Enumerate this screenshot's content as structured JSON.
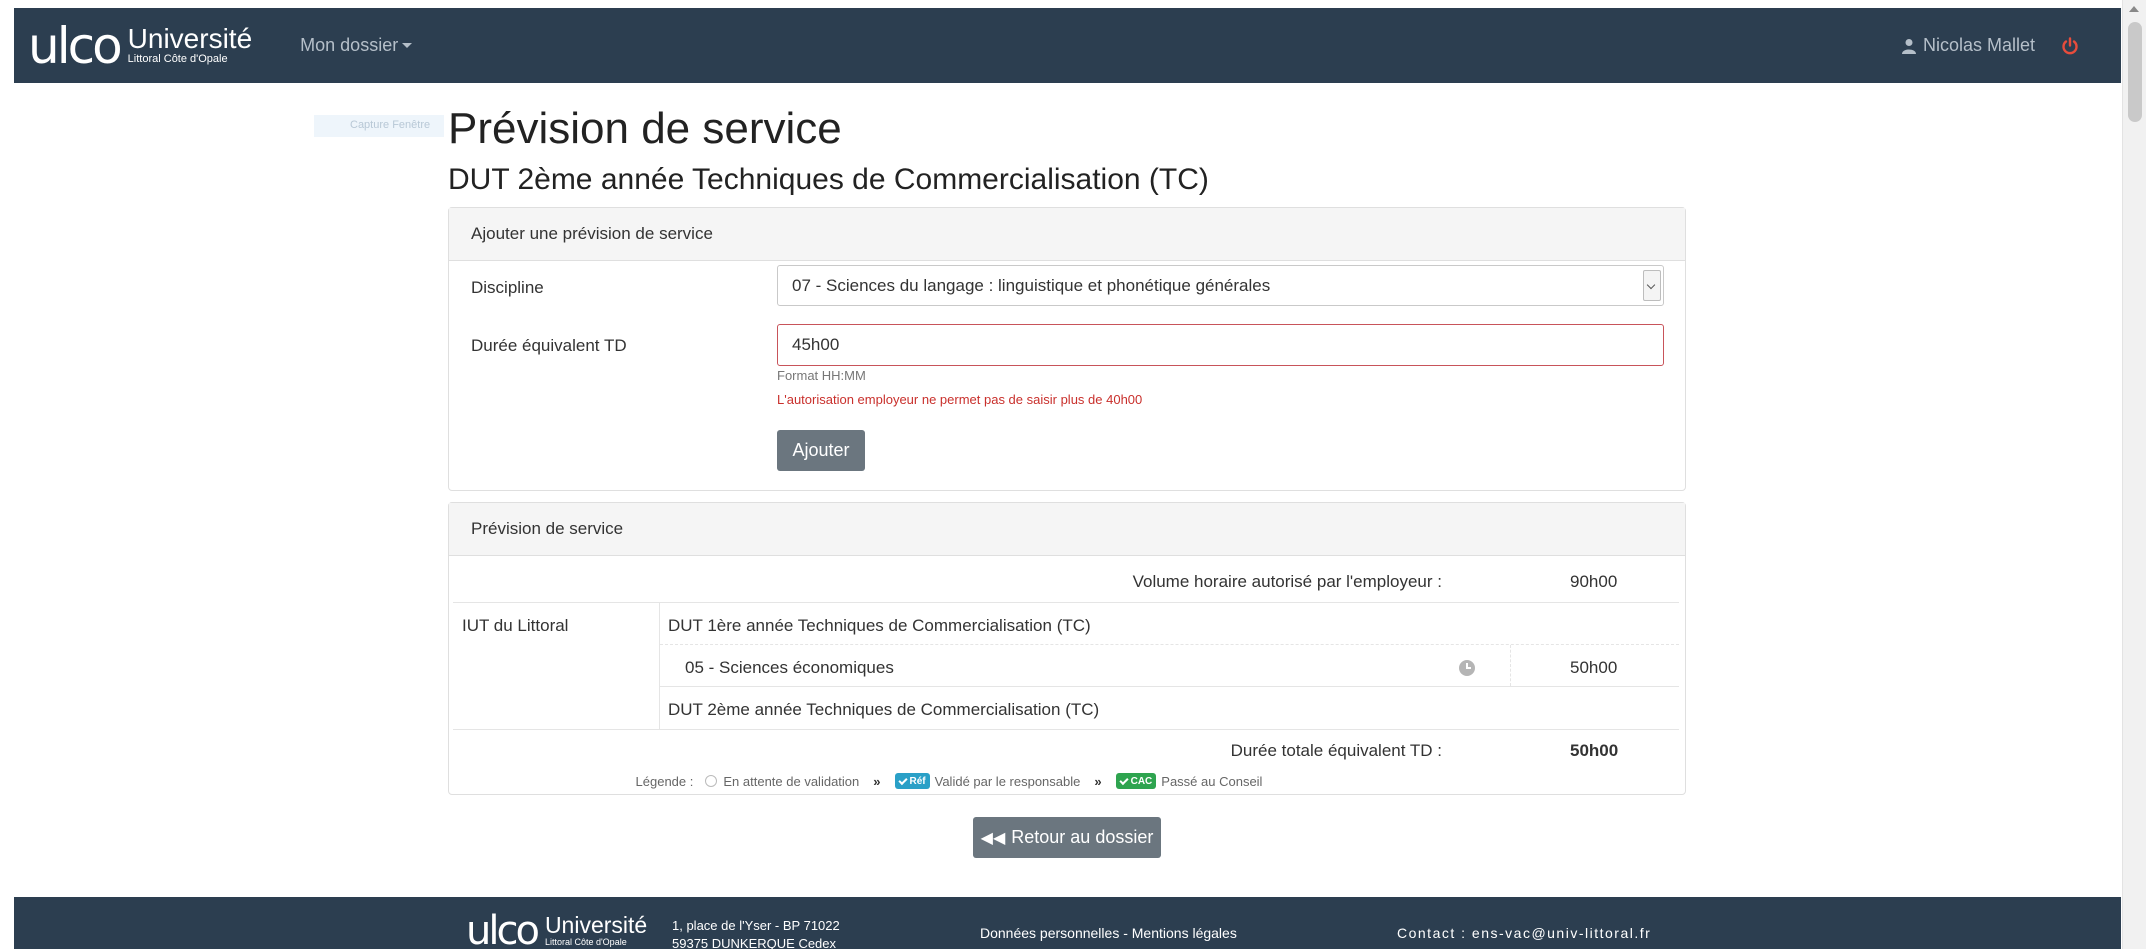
{
  "header": {
    "brand_logo": "ulco",
    "brand_name": "Université",
    "brand_sub": "Littoral Côte d'Opale",
    "menu_label": "Mon dossier",
    "user_name": "Nicolas Mallet"
  },
  "capture_label": "Capture Fenêtre",
  "page": {
    "title": "Prévision de service",
    "subtitle": "DUT 2ème année Techniques de Commercialisation (TC)"
  },
  "form": {
    "header": "Ajouter une prévision de service",
    "discipline_label": "Discipline",
    "discipline_value": "07 - Sciences du langage : linguistique et phonétique générales",
    "duree_label": "Durée équivalent TD",
    "duree_value": "45h00",
    "format_help": "Format HH:MM",
    "error_message": "L'autorisation employeur ne permet pas de saisir plus de 40h00",
    "add_button": "Ajouter"
  },
  "service": {
    "header": "Prévision de service",
    "authorized_label": "Volume horaire autorisé par l'employeur :",
    "authorized_value": "90h00",
    "establishment": "IUT du Littoral",
    "formation_1": "DUT 1ère année Techniques de Commercialisation (TC)",
    "discipline_1": "05 - Sciences économiques",
    "discipline_1_hours": "50h00",
    "formation_2": "DUT 2ème année Techniques de Commercialisation (TC)",
    "total_label": "Durée totale équivalent TD :",
    "total_value": "50h00"
  },
  "legend": {
    "label": "Légende :",
    "pending": "En attente de validation",
    "validated": "Validé par le responsable",
    "ref_badge": "Réf",
    "council": "Passé au Conseil",
    "cac_badge": "CAC"
  },
  "back_button": "Retour au dossier",
  "footer": {
    "address_line1": "1, place de l'Yser - BP 71022",
    "address_line2": "59375 DUNKERQUE Cedex",
    "links": "Données personnelles - Mentions légales",
    "contact": "Contact : ens-vac@univ-littoral.fr"
  },
  "colors": {
    "navbar": "#2c3e50",
    "error": "#c9302c",
    "button": "#6b767f",
    "power": "#e74c3c",
    "ref_badge": "#2aa0c7",
    "cac_badge": "#2ea44f"
  }
}
